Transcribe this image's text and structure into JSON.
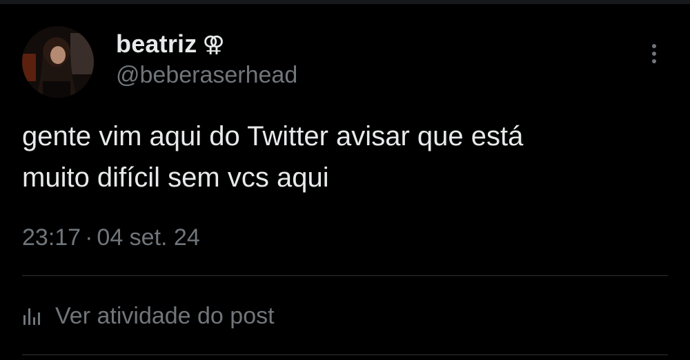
{
  "tweet": {
    "author": {
      "display_name": "beatriz",
      "name_emoji": "⚢",
      "handle": "@beberaserhead"
    },
    "text_lines": [
      "gente vim aqui do Twitter avisar que está",
      "muito difícil sem vcs aqui"
    ],
    "time": "23:17",
    "separator": "·",
    "date": "04 set. 24",
    "activity_label": "Ver atividade do post",
    "icons": {
      "more": "more-vertical-icon",
      "activity": "bar-chart-icon"
    }
  },
  "colors": {
    "background": "#000000",
    "primary_text": "#e7e9ea",
    "secondary_text": "#71767b",
    "divider": "#2f3336"
  }
}
